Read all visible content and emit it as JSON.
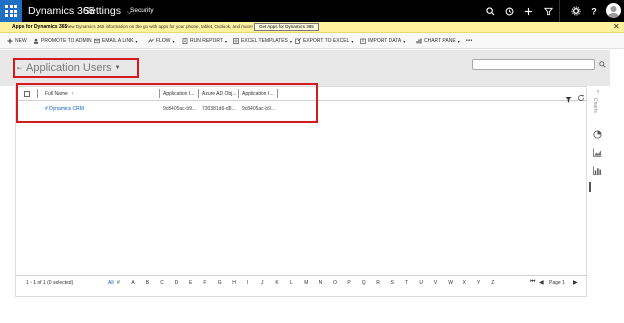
{
  "topnav": {
    "brand": "Dynamics 365",
    "area": "Settings",
    "area_caret": "⌵",
    "breadcrumb": "Security",
    "icons": [
      "search-icon",
      "history-icon",
      "plus-icon",
      "filter-icon",
      "gear-icon",
      "help-icon",
      "user-avatar"
    ]
  },
  "notice": {
    "label": "Apps for Dynamics 365",
    "text": "View Dynamics 365 information on the go with apps for your phone, tablet, Outlook, and more!",
    "button": "Get Apps for Dynamics 365",
    "close": "✕"
  },
  "commands": [
    {
      "label": "NEW",
      "icon": "plus-icon",
      "caret": false
    },
    {
      "label": "PROMOTE TO ADMIN",
      "icon": "promote-icon",
      "caret": false
    },
    {
      "label": "EMAIL A LINK",
      "icon": "email-icon",
      "caret": true
    },
    {
      "label": "FLOW",
      "icon": "flow-icon",
      "caret": true
    },
    {
      "label": "RUN REPORT",
      "icon": "report-icon",
      "caret": true
    },
    {
      "label": "EXCEL TEMPLATES",
      "icon": "excel-icon",
      "caret": true
    },
    {
      "label": "EXPORT TO EXCEL",
      "icon": "export-icon",
      "caret": true
    },
    {
      "label": "IMPORT DATA",
      "icon": "import-icon",
      "caret": true
    },
    {
      "label": "CHART PANE",
      "icon": "chart-icon",
      "caret": true
    },
    {
      "label": "•••",
      "icon": "",
      "caret": false
    }
  ],
  "caret": "▾",
  "view": {
    "pin": "⇤",
    "title": "Application Users",
    "caret": "▼"
  },
  "search": {
    "placeholder": ""
  },
  "grid": {
    "columns": [
      "Full Name",
      "Application I...",
      "Azure AD Obj...",
      "Application I..."
    ],
    "sort_indicator": "↑",
    "rows": [
      {
        "name": "# Dynamics CRM",
        "app_id": "9c8405ac-b9...",
        "azure_ad": "730381d6-d8...",
        "app_id_uri": "9c8405ac-b9..."
      }
    ]
  },
  "rail": {
    "collapse": "‹",
    "charts_label": "Charts"
  },
  "footer": {
    "record_count": "1 - 1 of 1 (0 selected)",
    "letters": [
      "All",
      "#",
      "A",
      "B",
      "C",
      "D",
      "E",
      "F",
      "G",
      "H",
      "I",
      "J",
      "K",
      "L",
      "M",
      "N",
      "O",
      "P",
      "Q",
      "R",
      "S",
      "T",
      "U",
      "V",
      "W",
      "X",
      "Y",
      "Z"
    ],
    "first_page": "⏮",
    "prev_page": "◀",
    "page_label": "Page 1",
    "next_page": "▶"
  }
}
